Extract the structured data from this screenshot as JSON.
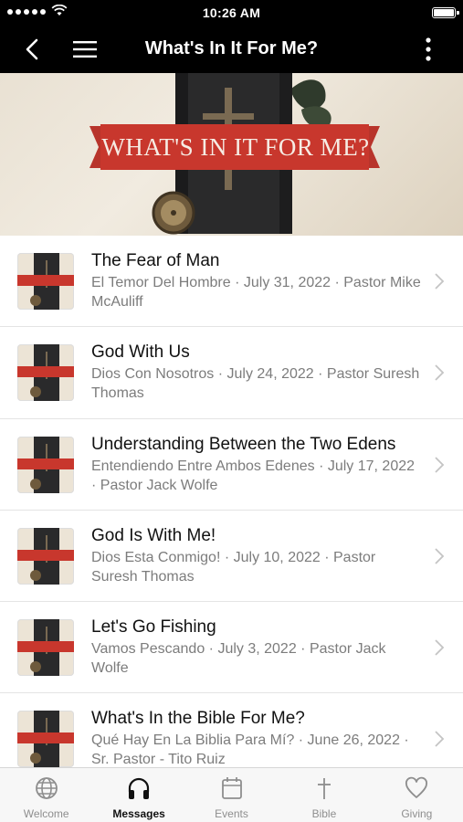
{
  "status_bar": {
    "time": "10:26 AM"
  },
  "nav": {
    "title": "What's In It For Me?"
  },
  "hero": {
    "title": "WHAT'S IN IT FOR ME?"
  },
  "thumbnail": {
    "title": "WHAT'S IN IT FOR ME"
  },
  "messages": [
    {
      "title": "The Fear of Man",
      "subtitle": "El Temor Del Hombre · July 31, 2022 · Pastor Mike McAuliff"
    },
    {
      "title": "God With Us",
      "subtitle": "Dios Con Nosotros · July 24, 2022 · Pastor Suresh Thomas"
    },
    {
      "title": "Understanding Between the Two Edens",
      "subtitle": "Entendiendo Entre Ambos Edenes · July 17, 2022 · Pastor Jack Wolfe"
    },
    {
      "title": "God Is With Me!",
      "subtitle": "Dios Esta Conmigo! · July 10, 2022 · Pastor Suresh Thomas"
    },
    {
      "title": "Let's Go Fishing",
      "subtitle": "Vamos Pescando · July 3, 2022 · Pastor Jack Wolfe"
    },
    {
      "title": "What's In the Bible For Me?",
      "subtitle": "Qué Hay En La Biblia Para Mí? · June 26, 2022 · Sr. Pastor - Tito Ruiz"
    }
  ],
  "tabs": [
    {
      "label": "Welcome",
      "icon": "globe-icon",
      "active": false
    },
    {
      "label": "Messages",
      "icon": "headphones-icon",
      "active": true
    },
    {
      "label": "Events",
      "icon": "calendar-icon",
      "active": false
    },
    {
      "label": "Bible",
      "icon": "cross-icon",
      "active": false
    },
    {
      "label": "Giving",
      "icon": "heart-icon",
      "active": false
    }
  ],
  "colors": {
    "bar": "#000000",
    "accent_red": "#c8372d",
    "active_tab": "#111111",
    "inactive_tab": "#8e8e8e"
  }
}
